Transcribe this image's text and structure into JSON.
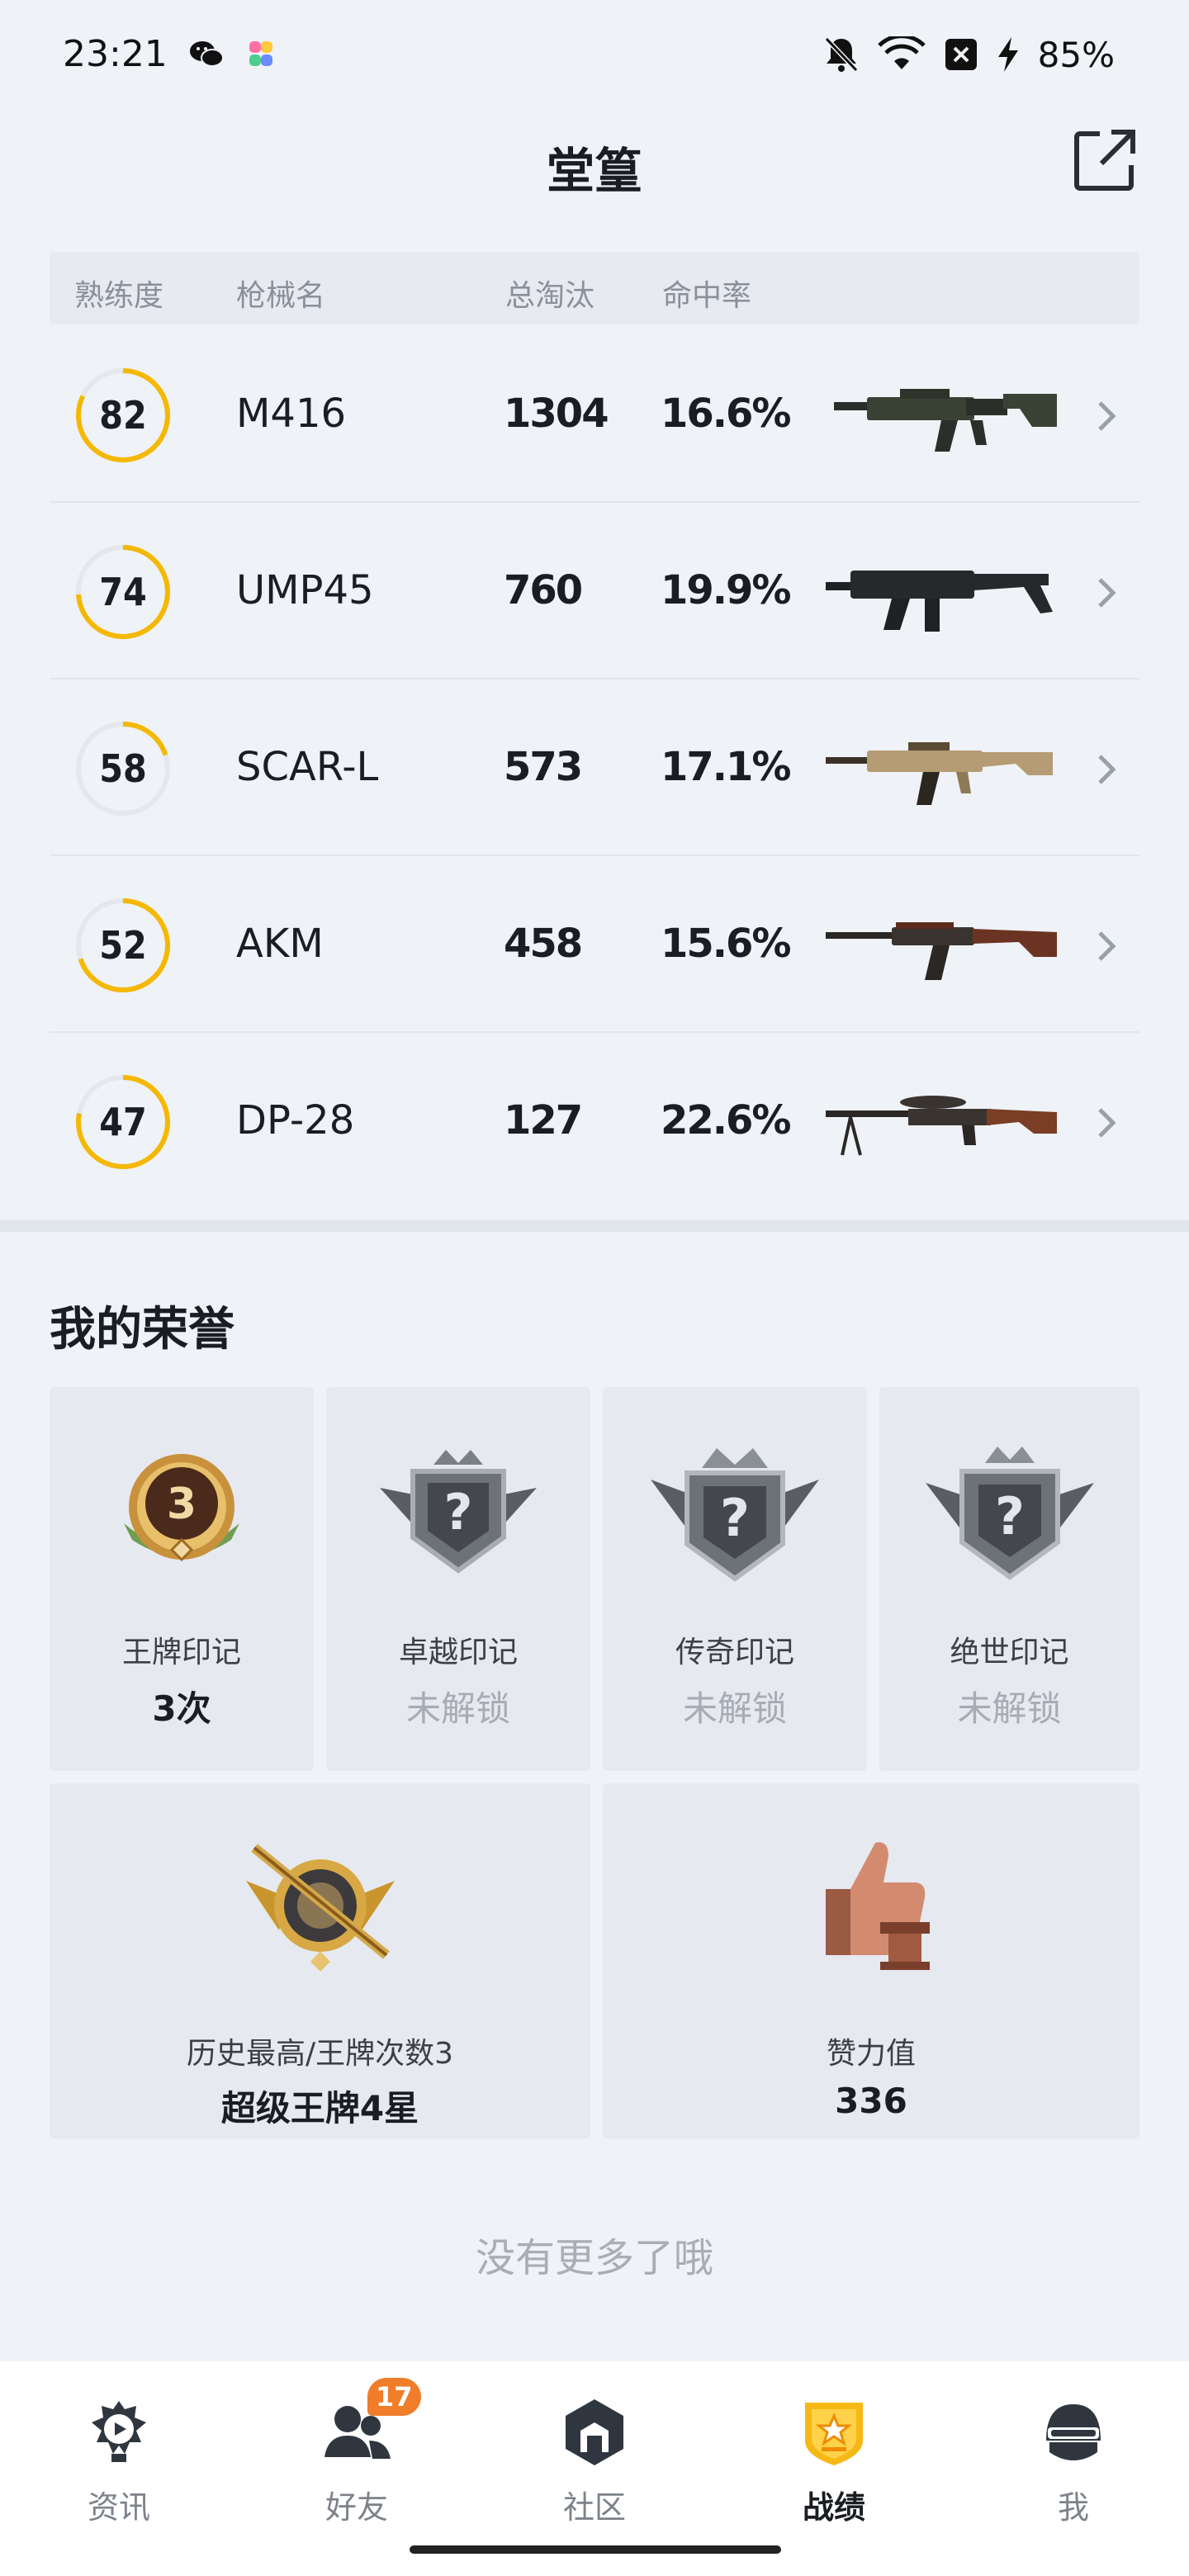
{
  "status_bar": {
    "time": "23:21",
    "battery_text": "85%",
    "icons": [
      "wechat-icon",
      "app-icon",
      "mute-icon",
      "wifi-icon",
      "sim-icon",
      "charging-icon"
    ]
  },
  "header": {
    "title": "堂篁",
    "share_icon": "share-external-icon"
  },
  "weapon_table": {
    "columns": {
      "mastery": "熟练度",
      "name": "枪械名",
      "kills": "总淘汰",
      "hit_rate": "命中率"
    },
    "accent_color": "#f5b800",
    "rows": [
      {
        "mastery": "82",
        "mastery_fraction": 0.82,
        "name": "M416",
        "kills": "1304",
        "hit_rate": "16.6%",
        "image": "m416-rifle-image"
      },
      {
        "mastery": "74",
        "mastery_fraction": 0.74,
        "name": "UMP45",
        "kills": "760",
        "hit_rate": "19.9%",
        "image": "ump45-smg-image"
      },
      {
        "mastery": "58",
        "mastery_fraction": 0.2,
        "name": "SCAR-L",
        "kills": "573",
        "hit_rate": "17.1%",
        "image": "scar-l-rifle-image"
      },
      {
        "mastery": "52",
        "mastery_fraction": 0.7,
        "name": "AKM",
        "kills": "458",
        "hit_rate": "15.6%",
        "image": "akm-rifle-image"
      },
      {
        "mastery": "47",
        "mastery_fraction": 0.78,
        "name": "DP-28",
        "kills": "127",
        "hit_rate": "22.6%",
        "image": "dp28-lmg-image"
      }
    ]
  },
  "honors": {
    "title": "我的荣誉",
    "marks": [
      {
        "name": "王牌印记",
        "value": "3次",
        "locked": false,
        "badge": "ace-mark-badge-icon",
        "badge_number": "3"
      },
      {
        "name": "卓越印记",
        "value": "未解锁",
        "locked": true,
        "badge": "excellence-mark-badge-icon"
      },
      {
        "name": "传奇印记",
        "value": "未解锁",
        "locked": true,
        "badge": "legend-mark-badge-icon"
      },
      {
        "name": "绝世印记",
        "value": "未解锁",
        "locked": true,
        "badge": "peerless-mark-badge-icon"
      }
    ],
    "highest": {
      "label": "历史最高/王牌次数3",
      "value": "超级王牌4星",
      "badge": "super-ace-badge-icon"
    },
    "likes": {
      "label": "赞力值",
      "value": "336",
      "badge": "thumbs-up-trophy-icon"
    }
  },
  "no_more_text": "没有更多了哦",
  "tabs": [
    {
      "label": "资讯",
      "icon": "news-icon",
      "active": false
    },
    {
      "label": "好友",
      "icon": "friends-icon",
      "active": false,
      "badge": "17"
    },
    {
      "label": "社区",
      "icon": "community-icon",
      "active": false
    },
    {
      "label": "战绩",
      "icon": "stats-badge-icon",
      "active": true
    },
    {
      "label": "我",
      "icon": "helmet-profile-icon",
      "active": false
    }
  ]
}
